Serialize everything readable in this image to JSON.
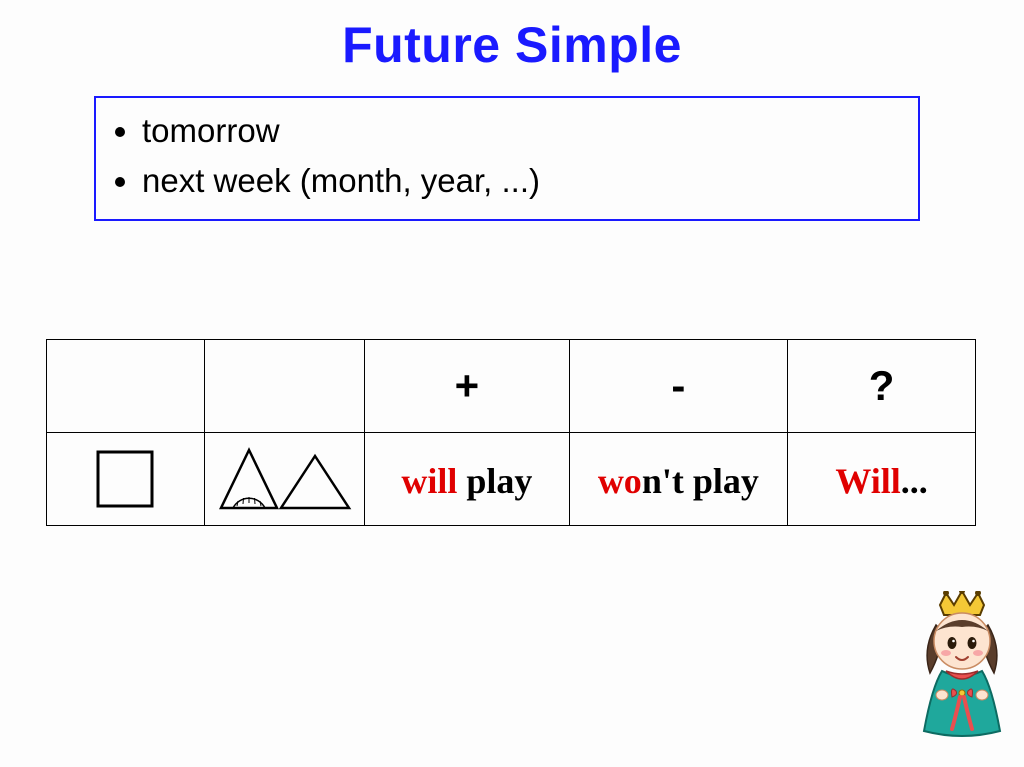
{
  "title": "Future Simple",
  "time_markers": {
    "items": [
      "tomorrow",
      "next week (month, year, ...)"
    ]
  },
  "table": {
    "headers": {
      "plus": "+",
      "minus": "-",
      "question": "?"
    },
    "row": {
      "affirm": {
        "aux": "will",
        "verb": " play"
      },
      "neg": {
        "aux": "wo",
        "rest": "n't play"
      },
      "quest": {
        "aux": "Will",
        "rest": "..."
      }
    }
  }
}
